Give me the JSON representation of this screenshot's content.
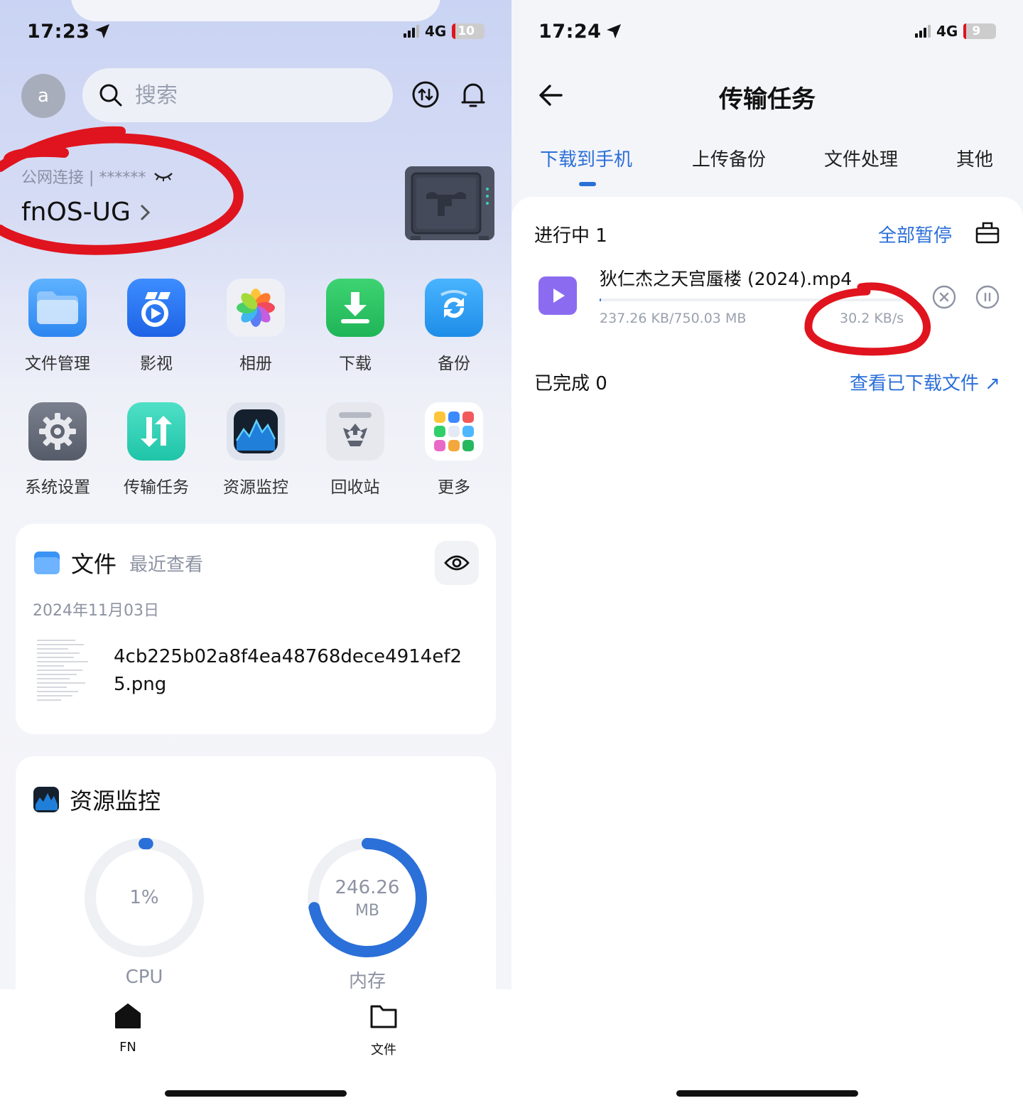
{
  "left": {
    "status": {
      "time": "17:23",
      "network": "4G",
      "battery": "10",
      "battery_level": 0.1
    },
    "header": {
      "avatar_letter": "a",
      "search_placeholder": "搜索"
    },
    "connection": {
      "label": "公网连接 | ******",
      "device_name": "fnOS-UG"
    },
    "apps": [
      {
        "label": "文件管理"
      },
      {
        "label": "影视"
      },
      {
        "label": "相册"
      },
      {
        "label": "下载"
      },
      {
        "label": "备份"
      },
      {
        "label": "系统设置"
      },
      {
        "label": "传输任务"
      },
      {
        "label": "资源监控"
      },
      {
        "label": "回收站"
      },
      {
        "label": "更多"
      }
    ],
    "files_card": {
      "title": "文件",
      "subtitle": "最近查看",
      "date": "2024年11月03日",
      "file_name": "4cb225b02a8f4ea48768dece4914ef25.png"
    },
    "monitor_card": {
      "title": "资源监控",
      "cpu": {
        "value_text": "1%",
        "label": "CPU",
        "fraction": 0.01
      },
      "memory": {
        "value_line1": "246.26",
        "value_line2": "MB",
        "label": "内存",
        "fraction": 0.72
      }
    },
    "tabbar": [
      {
        "label": "FN",
        "active": true
      },
      {
        "label": "文件",
        "active": false
      }
    ]
  },
  "right": {
    "status": {
      "time": "17:24",
      "network": "4G",
      "battery": "9",
      "battery_level": 0.09
    },
    "title": "传输任务",
    "tabs": [
      {
        "label": "下载到手机",
        "active": true
      },
      {
        "label": "上传备份",
        "active": false
      },
      {
        "label": "文件处理",
        "active": false
      },
      {
        "label": "其他",
        "active": false
      }
    ],
    "in_progress": {
      "label": "进行中 1",
      "pause_all": "全部暂停",
      "task": {
        "name": "狄仁杰之天宫蜃楼 (2024).mp4",
        "size": "237.26 KB/750.03 MB",
        "speed": "30.2 KB/s",
        "progress": 0.0003
      }
    },
    "completed": {
      "label": "已完成 0",
      "view_link": "查看已下载文件 ↗"
    }
  },
  "colors": {
    "accent": "#2b6fd8",
    "annotation": "#e0141e",
    "muted": "#8d93a3"
  }
}
